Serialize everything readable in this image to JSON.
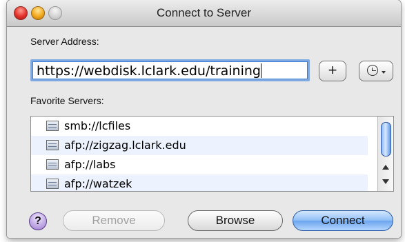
{
  "window": {
    "title": "Connect to Server"
  },
  "server": {
    "label": "Server Address:",
    "value": "https://webdisk.lclark.edu/training"
  },
  "buttons": {
    "add_label": "+",
    "remove_label": "Remove",
    "browse_label": "Browse",
    "connect_label": "Connect",
    "help_label": "?"
  },
  "favorites": {
    "label": "Favorite Servers:",
    "items": [
      {
        "label": "smb://lcfiles"
      },
      {
        "label": "afp://zigzag.lclark.edu"
      },
      {
        "label": "afp://labs"
      },
      {
        "label": "afp://watzek"
      }
    ]
  },
  "icons": {
    "close": "close-traffic-light",
    "minimize": "minimize-traffic-light",
    "zoom": "zoom-traffic-light",
    "recent": "clock-icon",
    "server": "network-server-icon",
    "help": "help-icon"
  },
  "colors": {
    "accent": "#6aa4ee",
    "focus_ring": "#7fa9e0",
    "alt_row": "#edf3fe"
  }
}
